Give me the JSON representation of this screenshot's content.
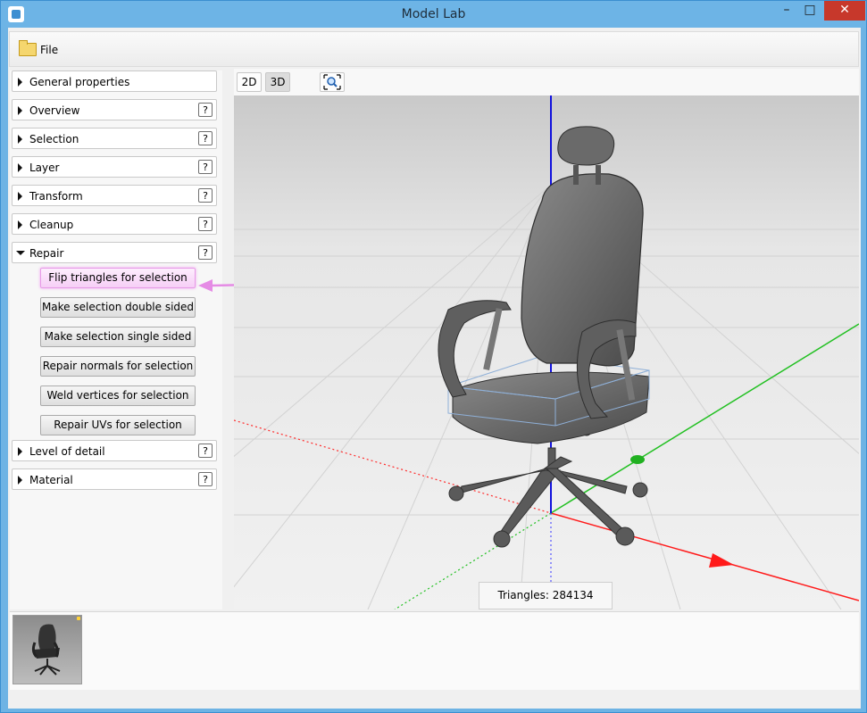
{
  "window": {
    "title": "Model Lab"
  },
  "menu": {
    "file_label": "File"
  },
  "sidebar": {
    "panels": [
      {
        "label": "General properties"
      },
      {
        "label": "Overview"
      },
      {
        "label": "Selection"
      },
      {
        "label": "Layer"
      },
      {
        "label": "Transform"
      },
      {
        "label": "Cleanup"
      },
      {
        "label": "Repair"
      },
      {
        "label": "Level of detail"
      },
      {
        "label": "Material"
      }
    ],
    "help_label": "?",
    "repair_actions": [
      "Flip triangles for selection",
      "Make selection double sided",
      "Make selection single sided",
      "Repair normals for selection",
      "Weld vertices for selection",
      "Repair UVs for selection"
    ]
  },
  "viewer": {
    "btn_2d": "2D",
    "btn_3d": "3D",
    "triangles_text": "Triangles: 284134"
  },
  "colors": {
    "x_axis": "#ff1a1a",
    "y_axis": "#1ec81e",
    "z_axis": "#1111dd",
    "highlight": "#e79be7"
  }
}
